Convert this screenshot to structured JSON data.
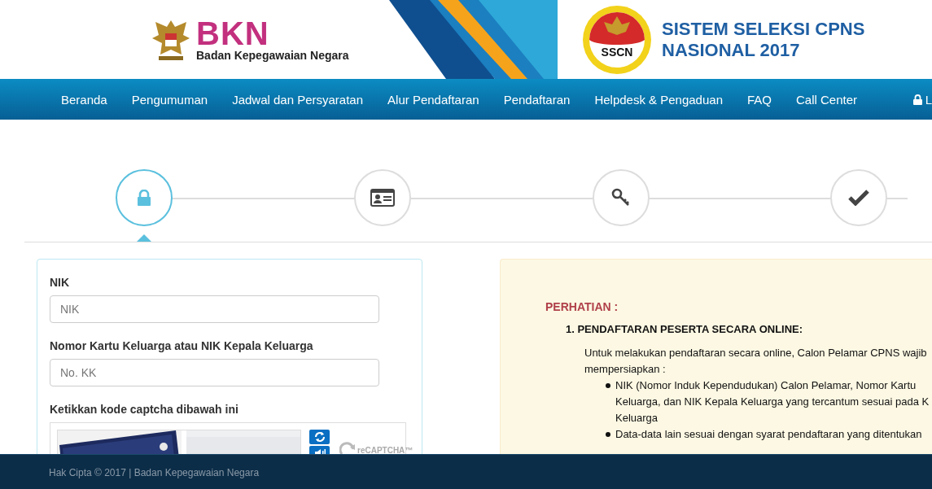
{
  "header": {
    "bkn_logo": {
      "abbr": "BKN",
      "name": "Badan Kepegawaian Negara"
    },
    "sscn_logo": {
      "abbr": "SSCN"
    },
    "title_lines": [
      "SISTEM SELEKSI CPNS",
      "NASIONAL 2017"
    ]
  },
  "nav": {
    "items": [
      "Beranda",
      "Pengumuman",
      "Jadwal dan Persyaratan",
      "Alur Pendaftaran",
      "Pendaftaran",
      "Helpdesk & Pengaduan",
      "FAQ",
      "Call Center"
    ],
    "login": "L"
  },
  "steps": [
    {
      "kind": "lock",
      "selected": true
    },
    {
      "kind": "id-card",
      "selected": false
    },
    {
      "kind": "key",
      "selected": false
    },
    {
      "kind": "check",
      "selected": false
    }
  ],
  "form": {
    "fields": [
      {
        "label": "NIK",
        "placeholder": "NIK"
      },
      {
        "label": "Nomor Kartu Keluarga atau NIK Kepala Keluarga",
        "placeholder": "No. KK"
      }
    ],
    "captcha_label": "Ketikkan kode captcha dibawah ini",
    "captcha": {
      "logo": "reCAPTCHA™"
    }
  },
  "notice": {
    "title": "PERHATIAN :",
    "section": "1. PENDAFTARAN PESERTA SECARA ONLINE:",
    "intro_lines": [
      "Untuk melakukan pendaftaran secara online, Calon Pelamar CPNS wajib",
      "mempersiapkan :"
    ],
    "bullets": [
      {
        "lines": [
          "NIK (Nomor Induk Kependudukan) Calon Pelamar, Nomor Kartu",
          "Keluarga, dan NIK Kepala Keluarga yang tercantum sesuai pada K",
          "Keluarga"
        ]
      },
      {
        "lines": [
          "Data-data lain sesuai dengan syarat pendaftaran yang ditentukan"
        ]
      }
    ]
  },
  "footer": {
    "text": "Hak Cipta © 2017 | Badan Kepegawaian Negara"
  }
}
